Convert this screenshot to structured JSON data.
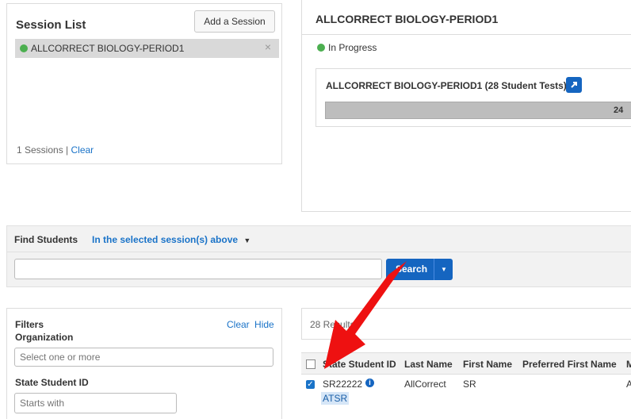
{
  "session_list": {
    "title": "Session List",
    "add_button": "Add a Session",
    "items": [
      {
        "name": "ALLCORRECT BIOLOGY-PERIOD1",
        "close": "×"
      }
    ],
    "count_text": "1 Sessions |",
    "clear_link": "Clear"
  },
  "session_detail": {
    "title": "ALLCORRECT BIOLOGY-PERIOD1",
    "status": "In Progress",
    "test_label": "ALLCORRECT BIOLOGY-PERIOD1 (28 Student Tests)",
    "progress_count": "24",
    "open_icon": "external-link-icon"
  },
  "find_students": {
    "label": "Find Students",
    "scope": "In the selected session(s) above",
    "search_button": "Search",
    "search_value": ""
  },
  "filters": {
    "title": "Filters",
    "clear_link": "Clear",
    "hide_link": "Hide",
    "organization_label": "Organization",
    "organization_placeholder": "Select one or more",
    "ssid_label": "State Student ID",
    "ssid_placeholder": "Starts with"
  },
  "results": {
    "count_text": "28 Results",
    "headers": [
      "State Student ID",
      "Last Name",
      "First Name",
      "Preferred First Name",
      "M"
    ],
    "rows": [
      {
        "ssid": "SR22222",
        "last": "AllCorrect",
        "first": "SR",
        "preferred": "",
        "m": "A",
        "sub": "ATSR",
        "checked": true
      }
    ]
  },
  "colors": {
    "accent": "#1a73c8",
    "button_blue": "#1565c0",
    "status_green": "#4caf50",
    "arrow_red": "#ee1111"
  }
}
